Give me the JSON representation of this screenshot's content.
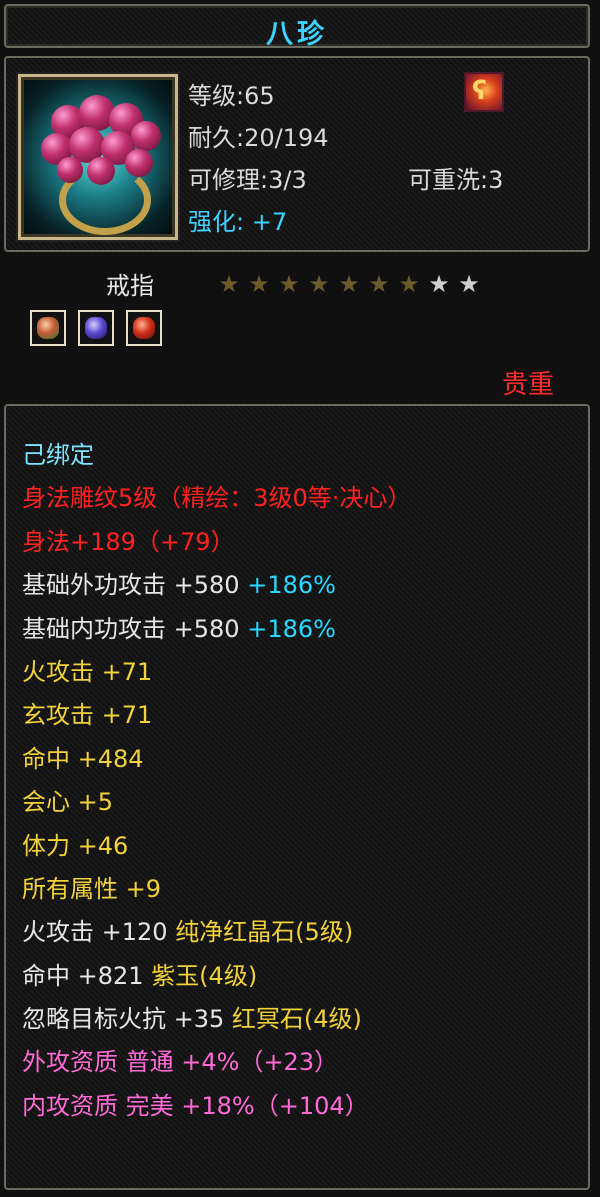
{
  "title": "八珍",
  "item": {
    "icon": "purple-berry-ring-icon",
    "badge_icon": "flame-spirit-icon",
    "level": "等级:65",
    "durability": "耐久:20/194",
    "repairable": "可修理:3/3",
    "rewash": "可重洗:3",
    "enhance_label": "强化:",
    "enhance_value": "+7",
    "type": "戒指",
    "stars_total": 9,
    "stars_filled": 7,
    "gems": [
      "green-gem-icon",
      "purple-gem-icon",
      "red-gem-icon"
    ],
    "rarity": "贵重"
  },
  "colors": {
    "title": "#3fd2ff",
    "bound": "#7fe3ff",
    "engrave": "#ff2020",
    "base": "#e6e6e6",
    "bonus": "#f2d23a",
    "percent": "#29d9ff",
    "quality": "#ff6bd6"
  },
  "attributes": {
    "bound": "己绑定",
    "engrave": "身法雕纹5级（精绘：3级0等·决心）",
    "agility_a": "身法",
    "agility_b": "+189（+79）",
    "ext_attack_label": "基础外功攻击",
    "ext_attack_value": "+580",
    "ext_attack_pct": "+186%",
    "int_attack_label": "基础内功攻击",
    "int_attack_value": "+580",
    "int_attack_pct": "+186%",
    "fire_attack": "火攻击 +71",
    "mystic_attack": "玄攻击 +71",
    "hit": "命中 +484",
    "crit": "会心 +5",
    "stamina": "体力 +46",
    "all_attr": "所有属性 +9",
    "gem1_stat": "火攻击 +120",
    "gem1_name": "纯净红晶石(5级)",
    "gem2_stat": "命中 +821",
    "gem2_name": "紫玉(4级)",
    "gem3_stat": "忽略目标火抗 +35",
    "gem3_name": "红冥石(4级)",
    "ext_quality": "外攻资质  普通 +4%（+23）",
    "int_quality": "内攻资质  完美 +18%（+104）"
  }
}
